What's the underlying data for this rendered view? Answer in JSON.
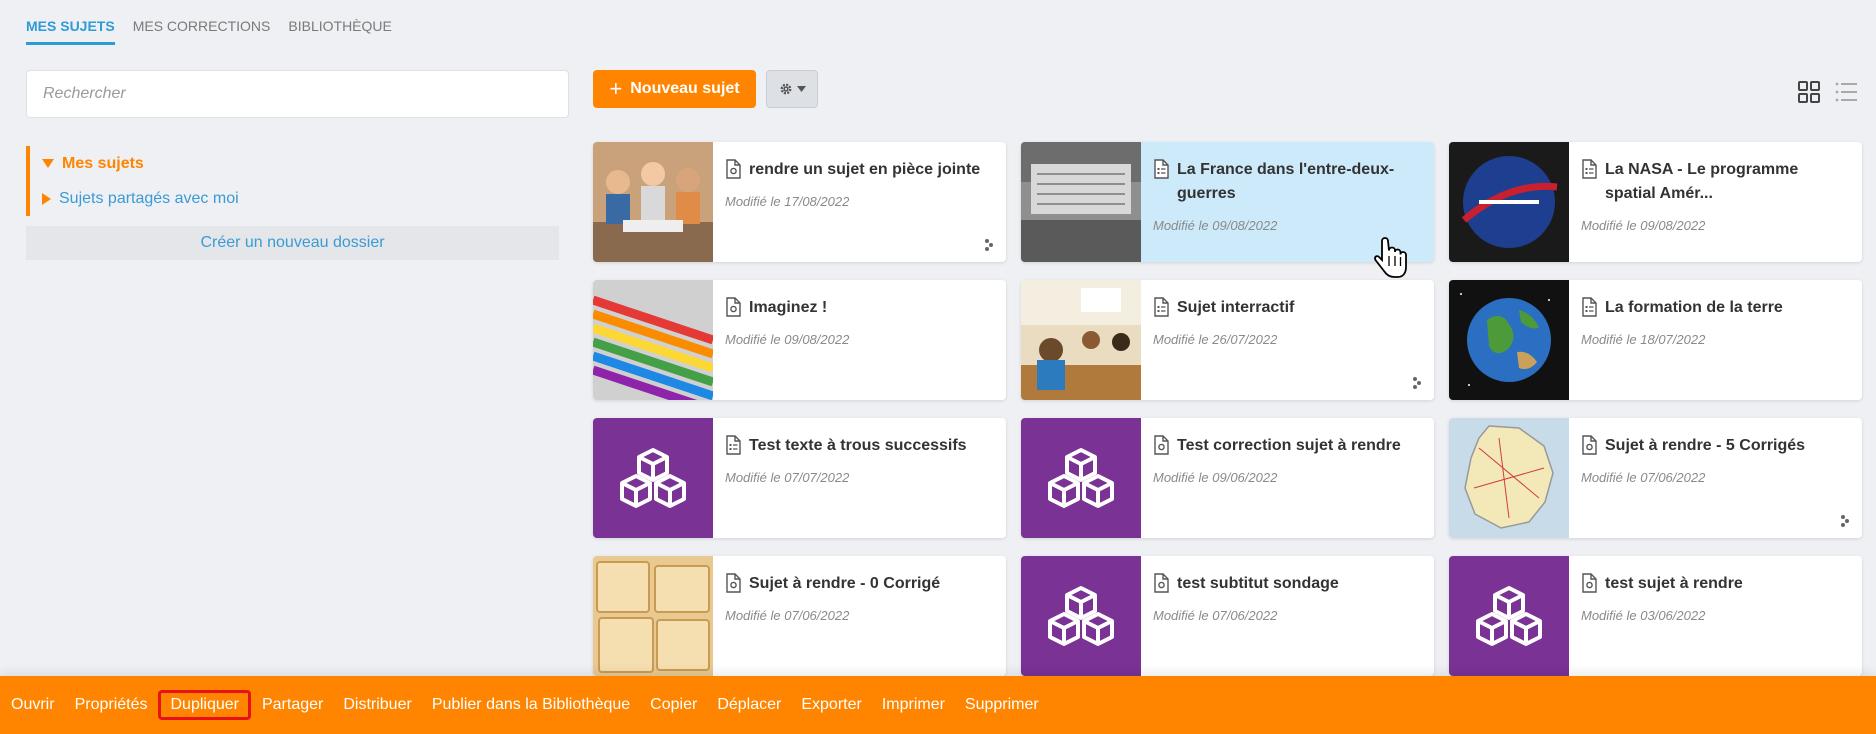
{
  "tabs": [
    {
      "label": "MES SUJETS",
      "active": true
    },
    {
      "label": "MES CORRECTIONS",
      "active": false
    },
    {
      "label": "BIBLIOTHÈQUE",
      "active": false
    }
  ],
  "sidebar": {
    "search_placeholder": "Rechercher",
    "tree": [
      {
        "label": "Mes sujets",
        "expanded": true,
        "active": true
      },
      {
        "label": "Sujets partagés avec moi",
        "expanded": false,
        "active": false
      }
    ],
    "new_folder_label": "Créer un nouveau dossier"
  },
  "toolbar": {
    "new_subject_label": "Nouveau sujet",
    "settings_icon": "gear-icon",
    "views": [
      "grid-view-icon",
      "list-view-icon"
    ],
    "active_view": "grid"
  },
  "cards": [
    {
      "title": "rendre un sujet en pièce jointe",
      "date": "Modifié le 17/08/2022",
      "icon": "attachment-doc-icon",
      "thumb": "students-photo",
      "shared": true,
      "highlight": false
    },
    {
      "title": "La France dans l'entre-deux-guerres",
      "date": "Modifié le 09/08/2022",
      "icon": "interactive-doc-icon",
      "thumb": "protest-photo",
      "shared": false,
      "highlight": true
    },
    {
      "title": "La NASA - Le programme spatial Amér...",
      "date": "Modifié le 09/08/2022",
      "icon": "interactive-doc-icon",
      "thumb": "nasa-logo",
      "shared": false,
      "highlight": false
    },
    {
      "title": "Imaginez !",
      "date": "Modifié le 09/08/2022",
      "icon": "attachment-doc-icon",
      "thumb": "pencils-photo",
      "shared": false,
      "highlight": false
    },
    {
      "title": "Sujet interractif",
      "date": "Modifié le 26/07/2022",
      "icon": "interactive-doc-icon",
      "thumb": "classroom-photo",
      "shared": true,
      "highlight": false
    },
    {
      "title": "La formation de la terre",
      "date": "Modifié le 18/07/2022",
      "icon": "interactive-doc-icon",
      "thumb": "earth-photo",
      "shared": false,
      "highlight": false
    },
    {
      "title": "Test texte à trous successifs",
      "date": "Modifié le 07/07/2022",
      "icon": "interactive-doc-icon",
      "thumb": "cubes-placeholder",
      "shared": false,
      "highlight": false
    },
    {
      "title": "Test correction sujet à rendre",
      "date": "Modifié le 09/06/2022",
      "icon": "attachment-doc-icon",
      "thumb": "cubes-placeholder",
      "shared": false,
      "highlight": false
    },
    {
      "title": "Sujet à rendre - 5 Corrigés",
      "date": "Modifié le 07/06/2022",
      "icon": "attachment-doc-icon",
      "thumb": "france-map",
      "shared": true,
      "highlight": false
    },
    {
      "title": "Sujet à rendre - 0 Corrigé",
      "date": "Modifié le 07/06/2022",
      "icon": "attachment-doc-icon",
      "thumb": "crackers-photo",
      "shared": false,
      "highlight": false
    },
    {
      "title": "test subtitut sondage",
      "date": "Modifié le 07/06/2022",
      "icon": "attachment-doc-icon",
      "thumb": "cubes-placeholder",
      "shared": false,
      "highlight": false
    },
    {
      "title": "test sujet à rendre",
      "date": "Modifié le 03/06/2022",
      "icon": "attachment-doc-icon",
      "thumb": "cubes-placeholder",
      "shared": false,
      "highlight": false
    }
  ],
  "actions": [
    {
      "label": "Ouvrir",
      "selected": false
    },
    {
      "label": "Propriétés",
      "selected": false
    },
    {
      "label": "Dupliquer",
      "selected": true
    },
    {
      "label": "Partager",
      "selected": false
    },
    {
      "label": "Distribuer",
      "selected": false
    },
    {
      "label": "Publier dans la Bibliothèque",
      "selected": false
    },
    {
      "label": "Copier",
      "selected": false
    },
    {
      "label": "Déplacer",
      "selected": false
    },
    {
      "label": "Exporter",
      "selected": false
    },
    {
      "label": "Imprimer",
      "selected": false
    },
    {
      "label": "Supprimer",
      "selected": false
    }
  ],
  "colors": {
    "accent": "#ff8500",
    "link": "#3b9bd3",
    "tab_active": "#2e9bd6",
    "placeholder_thumb": "#7a3294",
    "highlight_card": "#cdeafa",
    "selection_outline": "#e8131a"
  }
}
